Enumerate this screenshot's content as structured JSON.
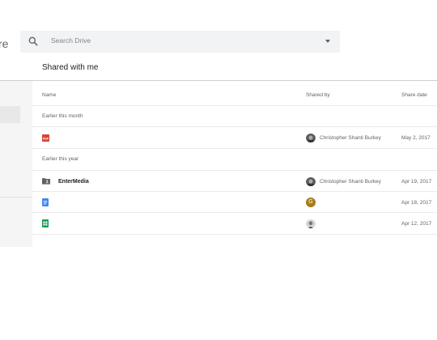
{
  "app": {
    "brand_fragment": "re"
  },
  "search": {
    "placeholder": "Search Drive"
  },
  "page": {
    "title": "Shared with me"
  },
  "table": {
    "columns": {
      "name": "Name",
      "shared_by": "Shared by",
      "share_date": "Share date"
    },
    "sections": [
      {
        "label": "Earlier this month",
        "rows": [
          {
            "icon": "pdf-file-icon",
            "name": "",
            "shared_by": "Christopher Shanti Burkey",
            "avatar": "photo-avatar",
            "date": "May 2, 2017"
          }
        ]
      },
      {
        "label": "Earlier this year",
        "rows": [
          {
            "icon": "shared-folder-icon",
            "name": "EnterMedia",
            "shared_by": "Christopher Shanti Burkey",
            "avatar": "photo-avatar",
            "date": "Apr 19, 2017"
          },
          {
            "icon": "google-docs-icon",
            "name": "",
            "shared_by": "",
            "avatar": "letter-avatar",
            "avatar_letter": "G",
            "date": "Apr 18, 2017"
          },
          {
            "icon": "google-sheets-icon",
            "name": "",
            "shared_by": "",
            "avatar": "photo-avatar",
            "date": "Apr 12, 2017"
          }
        ]
      }
    ]
  },
  "colors": {
    "pdf": "#db4437",
    "docs": "#4285f4",
    "sheets": "#0f9d58",
    "folder": "#5f6368",
    "avatar_g": "#a57d1a"
  }
}
